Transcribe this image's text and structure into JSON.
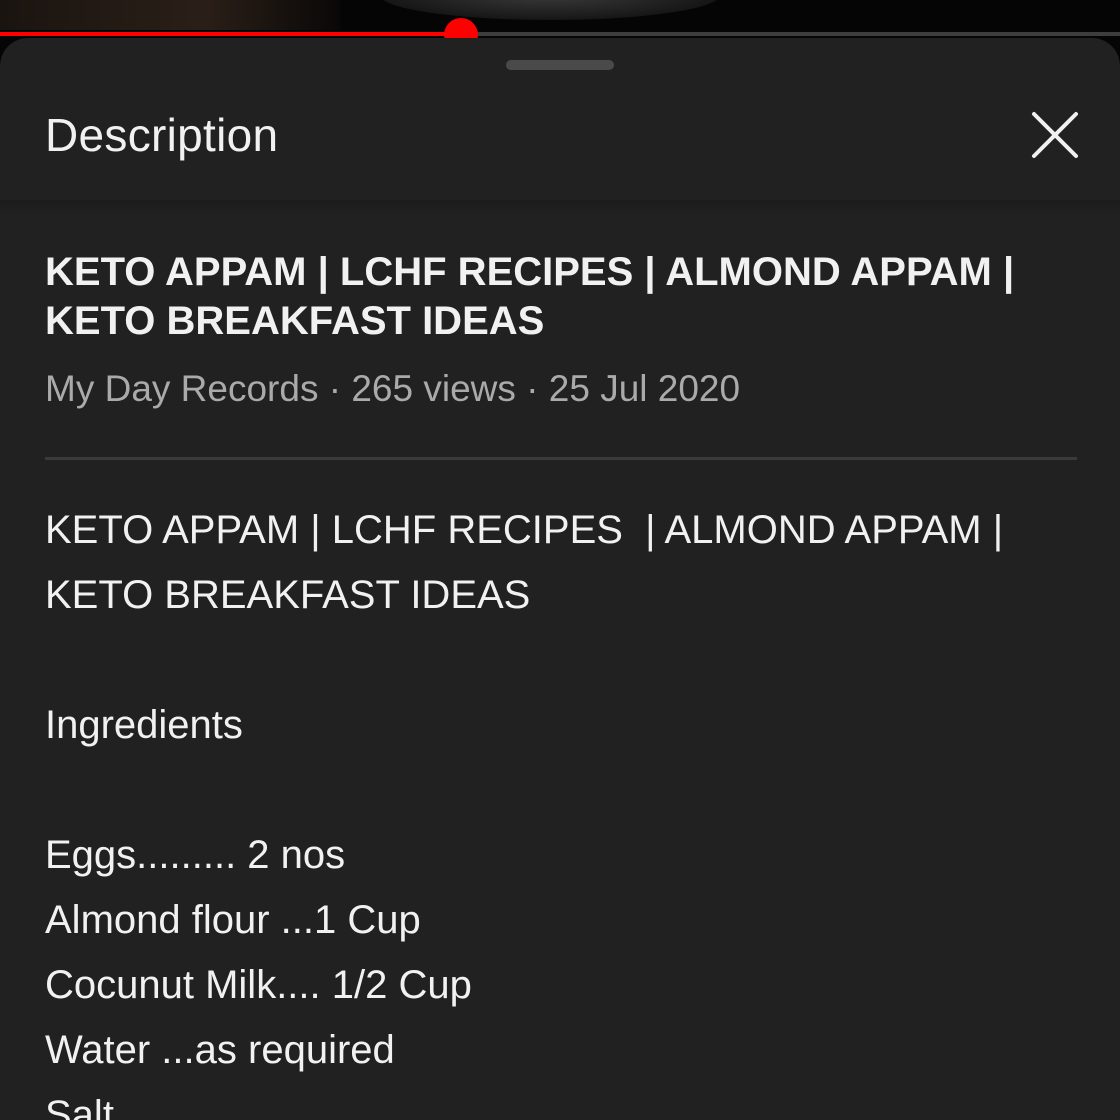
{
  "player": {
    "progress_fraction": 0.412
  },
  "sheet": {
    "title": "Description",
    "close_icon": "close-icon"
  },
  "video": {
    "title_line1": "KETO APPAM | LCHF RECIPES | ALMOND APPAM |",
    "title_line2": "KETO BREAKFAST IDEAS",
    "channel": "My Day Records",
    "views": "265 views",
    "date": "25 Jul 2020",
    "separator": " · "
  },
  "description": {
    "lines": [
      "KETO APPAM | LCHF RECIPES  | ALMOND APPAM |",
      "KETO BREAKFAST IDEAS",
      "",
      "Ingredients",
      "",
      "Eggs......... 2 nos",
      "Almond flour ...1 Cup",
      "Cocunut Milk.... 1/2 Cup",
      "Water ...as required",
      "Salt"
    ]
  },
  "colors": {
    "accent": "#ff0000",
    "sheet_bg": "#212121",
    "text_primary": "#f1f1f1",
    "text_secondary": "#aaaaaa"
  }
}
